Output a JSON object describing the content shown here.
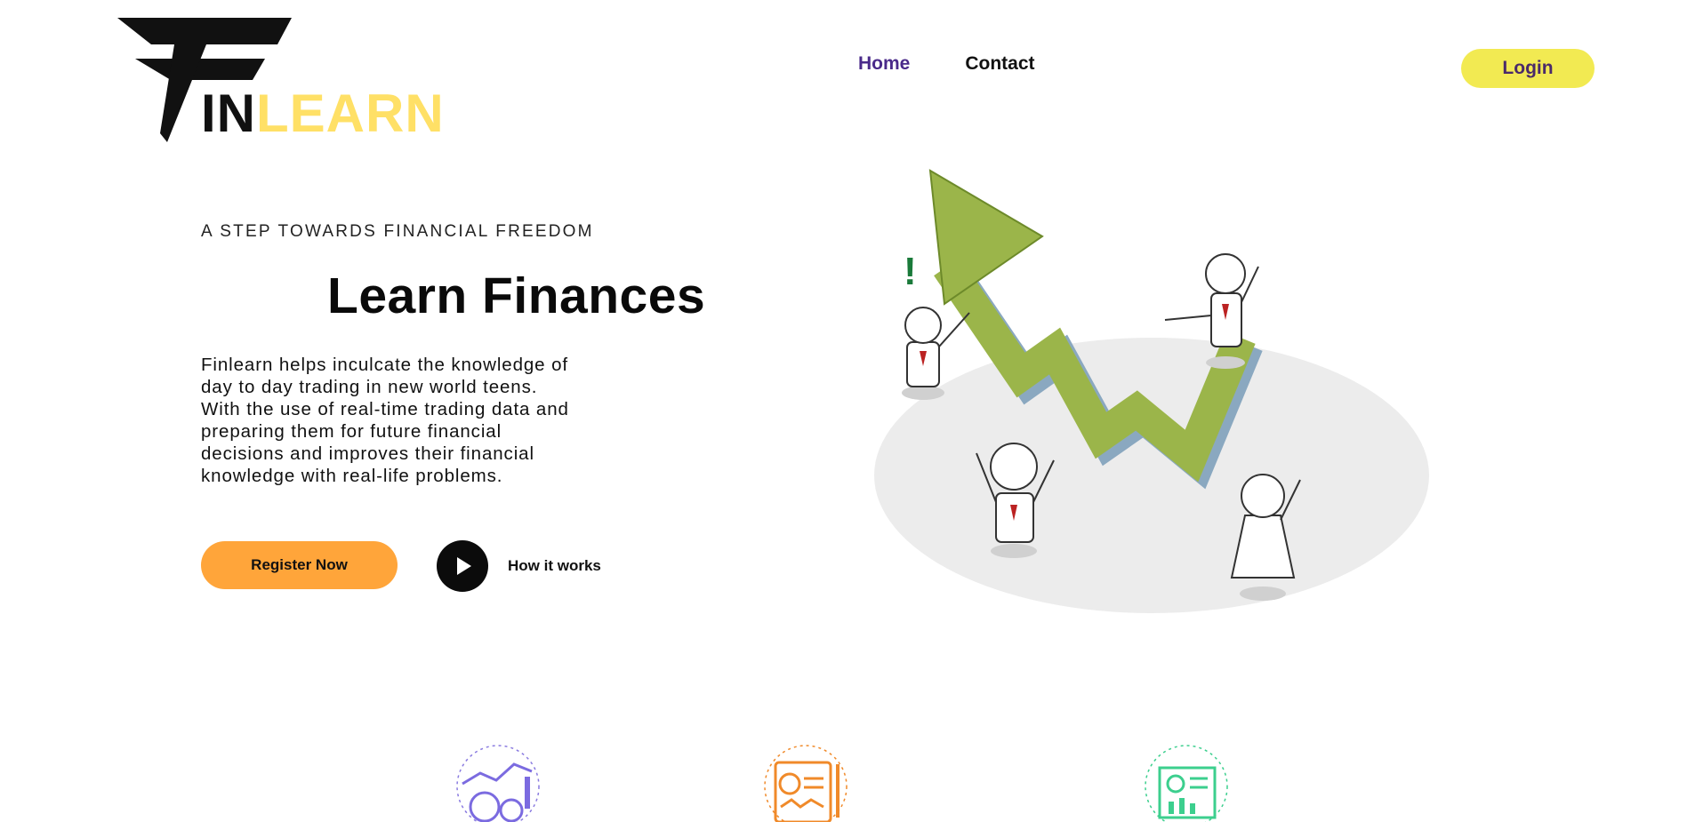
{
  "brand": {
    "logo_in": "IN",
    "logo_learn": "LEARN"
  },
  "nav": {
    "items": [
      {
        "label": "Home",
        "active": true
      },
      {
        "label": "Contact",
        "active": false
      }
    ]
  },
  "header": {
    "login_label": "Login"
  },
  "hero": {
    "tagline": "A STEP TOWARDS FINANCIAL FREEDOM",
    "headline": "Learn Finances",
    "description": "Finlearn helps inculcate the knowledge of day to day trading in new world teens. With the use of real-time trading data and preparing them for future financial decisions and improves their financial knowledge with real-life problems.",
    "register_label": "Register Now",
    "how_label": "How it works"
  },
  "colors": {
    "accent_yellow": "#f2ea52",
    "logo_yellow": "#ffe066",
    "cta_orange": "#ffa53a",
    "nav_active": "#4a2a8a",
    "arrow_green": "#9bb54a"
  },
  "icons": {
    "illustration": "growth-arrow-illustration",
    "features": [
      "analytics-gears-icon",
      "report-document-icon",
      "presentation-board-icon"
    ]
  }
}
